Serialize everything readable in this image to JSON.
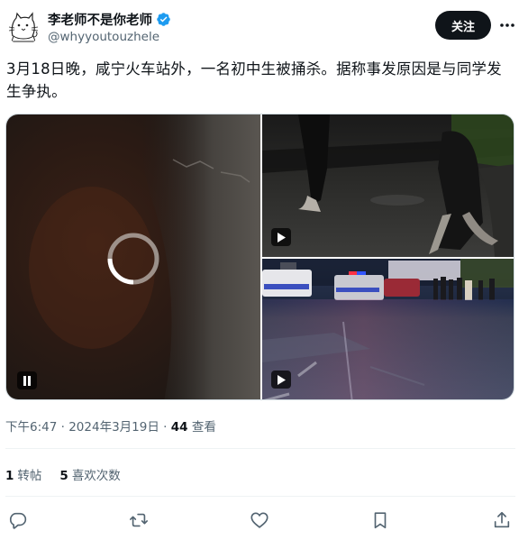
{
  "author": {
    "display_name": "李老师不是你老师",
    "handle": "@whyyoutouzhele",
    "avatar_icon": "cat-sketch-avatar",
    "verified_icon": "verified-badge-icon",
    "verified_color": "#1d9bf0"
  },
  "header": {
    "follow_label": "关注",
    "more_icon": "more-options-icon"
  },
  "tweet": {
    "text_line1": "3月18日晚，咸宁火车站外，一名初中生被捅杀。据称事发原因是与同学发",
    "text_line2": "生争执。"
  },
  "media": {
    "items": [
      {
        "type": "video",
        "state": "loading",
        "control_icon": "pause-icon"
      },
      {
        "type": "video",
        "state": "paused",
        "control_icon": "play-icon"
      },
      {
        "type": "video",
        "state": "paused",
        "control_icon": "play-icon"
      }
    ]
  },
  "meta": {
    "time": "下午6:47",
    "separator": "·",
    "date": "2024年3月19日",
    "views_count": "44",
    "views_label": "查看"
  },
  "stats": {
    "reposts_count": "1",
    "reposts_label": "转帖",
    "likes_count": "5",
    "likes_label": "喜欢次数"
  },
  "actions": [
    "reply-icon",
    "repost-icon",
    "like-icon",
    "bookmark-icon",
    "share-icon"
  ],
  "colors": {
    "text_primary": "#0f1419",
    "text_secondary": "#536471",
    "divider": "#eff3f4",
    "follow_bg": "#0f1419"
  }
}
